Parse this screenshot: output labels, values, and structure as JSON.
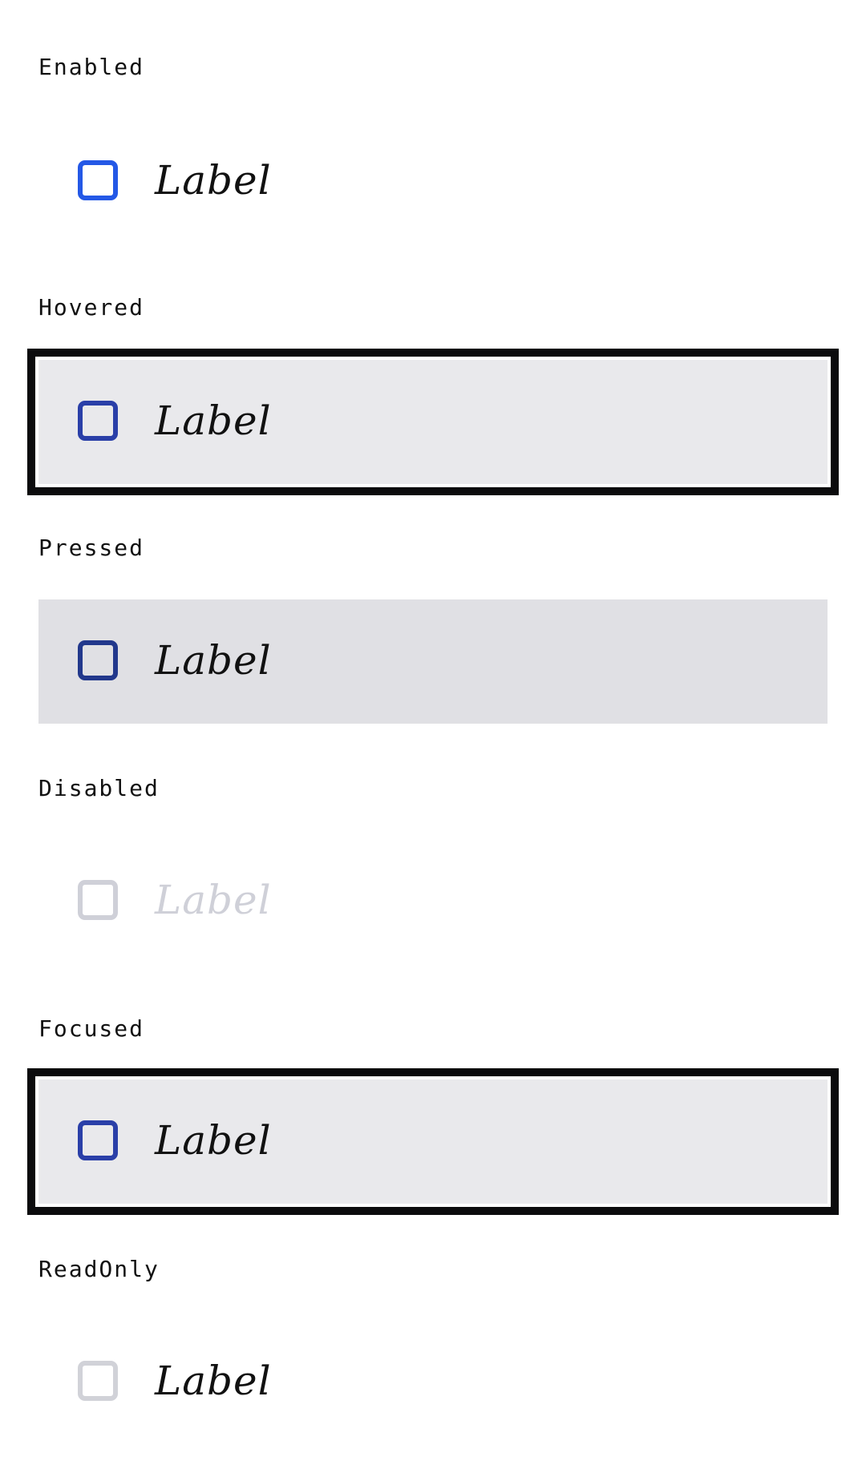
{
  "states": [
    {
      "title": "Enabled",
      "label": "Label",
      "checkbox_color": "#2458e6",
      "label_color": "#111111",
      "background": ""
    },
    {
      "title": "Hovered",
      "label": "Label",
      "checkbox_color": "#2a3fa8",
      "label_color": "#111111",
      "background": "#e9e9ec",
      "outline_color": "#0b0b0d"
    },
    {
      "title": "Pressed",
      "label": "Label",
      "checkbox_color": "#22388c",
      "label_color": "#111111",
      "background": "#e0e0e4"
    },
    {
      "title": "Disabled",
      "label": "Label",
      "checkbox_color": "#cfd0d8",
      "label_color": "#cfd0d8",
      "background": ""
    },
    {
      "title": "Focused",
      "label": "Label",
      "checkbox_color": "#2a3fa8",
      "label_color": "#111111",
      "background": "#e9e9ec",
      "outline_color": "#0b0b0d"
    },
    {
      "title": "ReadOnly",
      "label": "Label",
      "checkbox_color": "#d1d2d8",
      "label_color": "#111111",
      "background": ""
    }
  ]
}
